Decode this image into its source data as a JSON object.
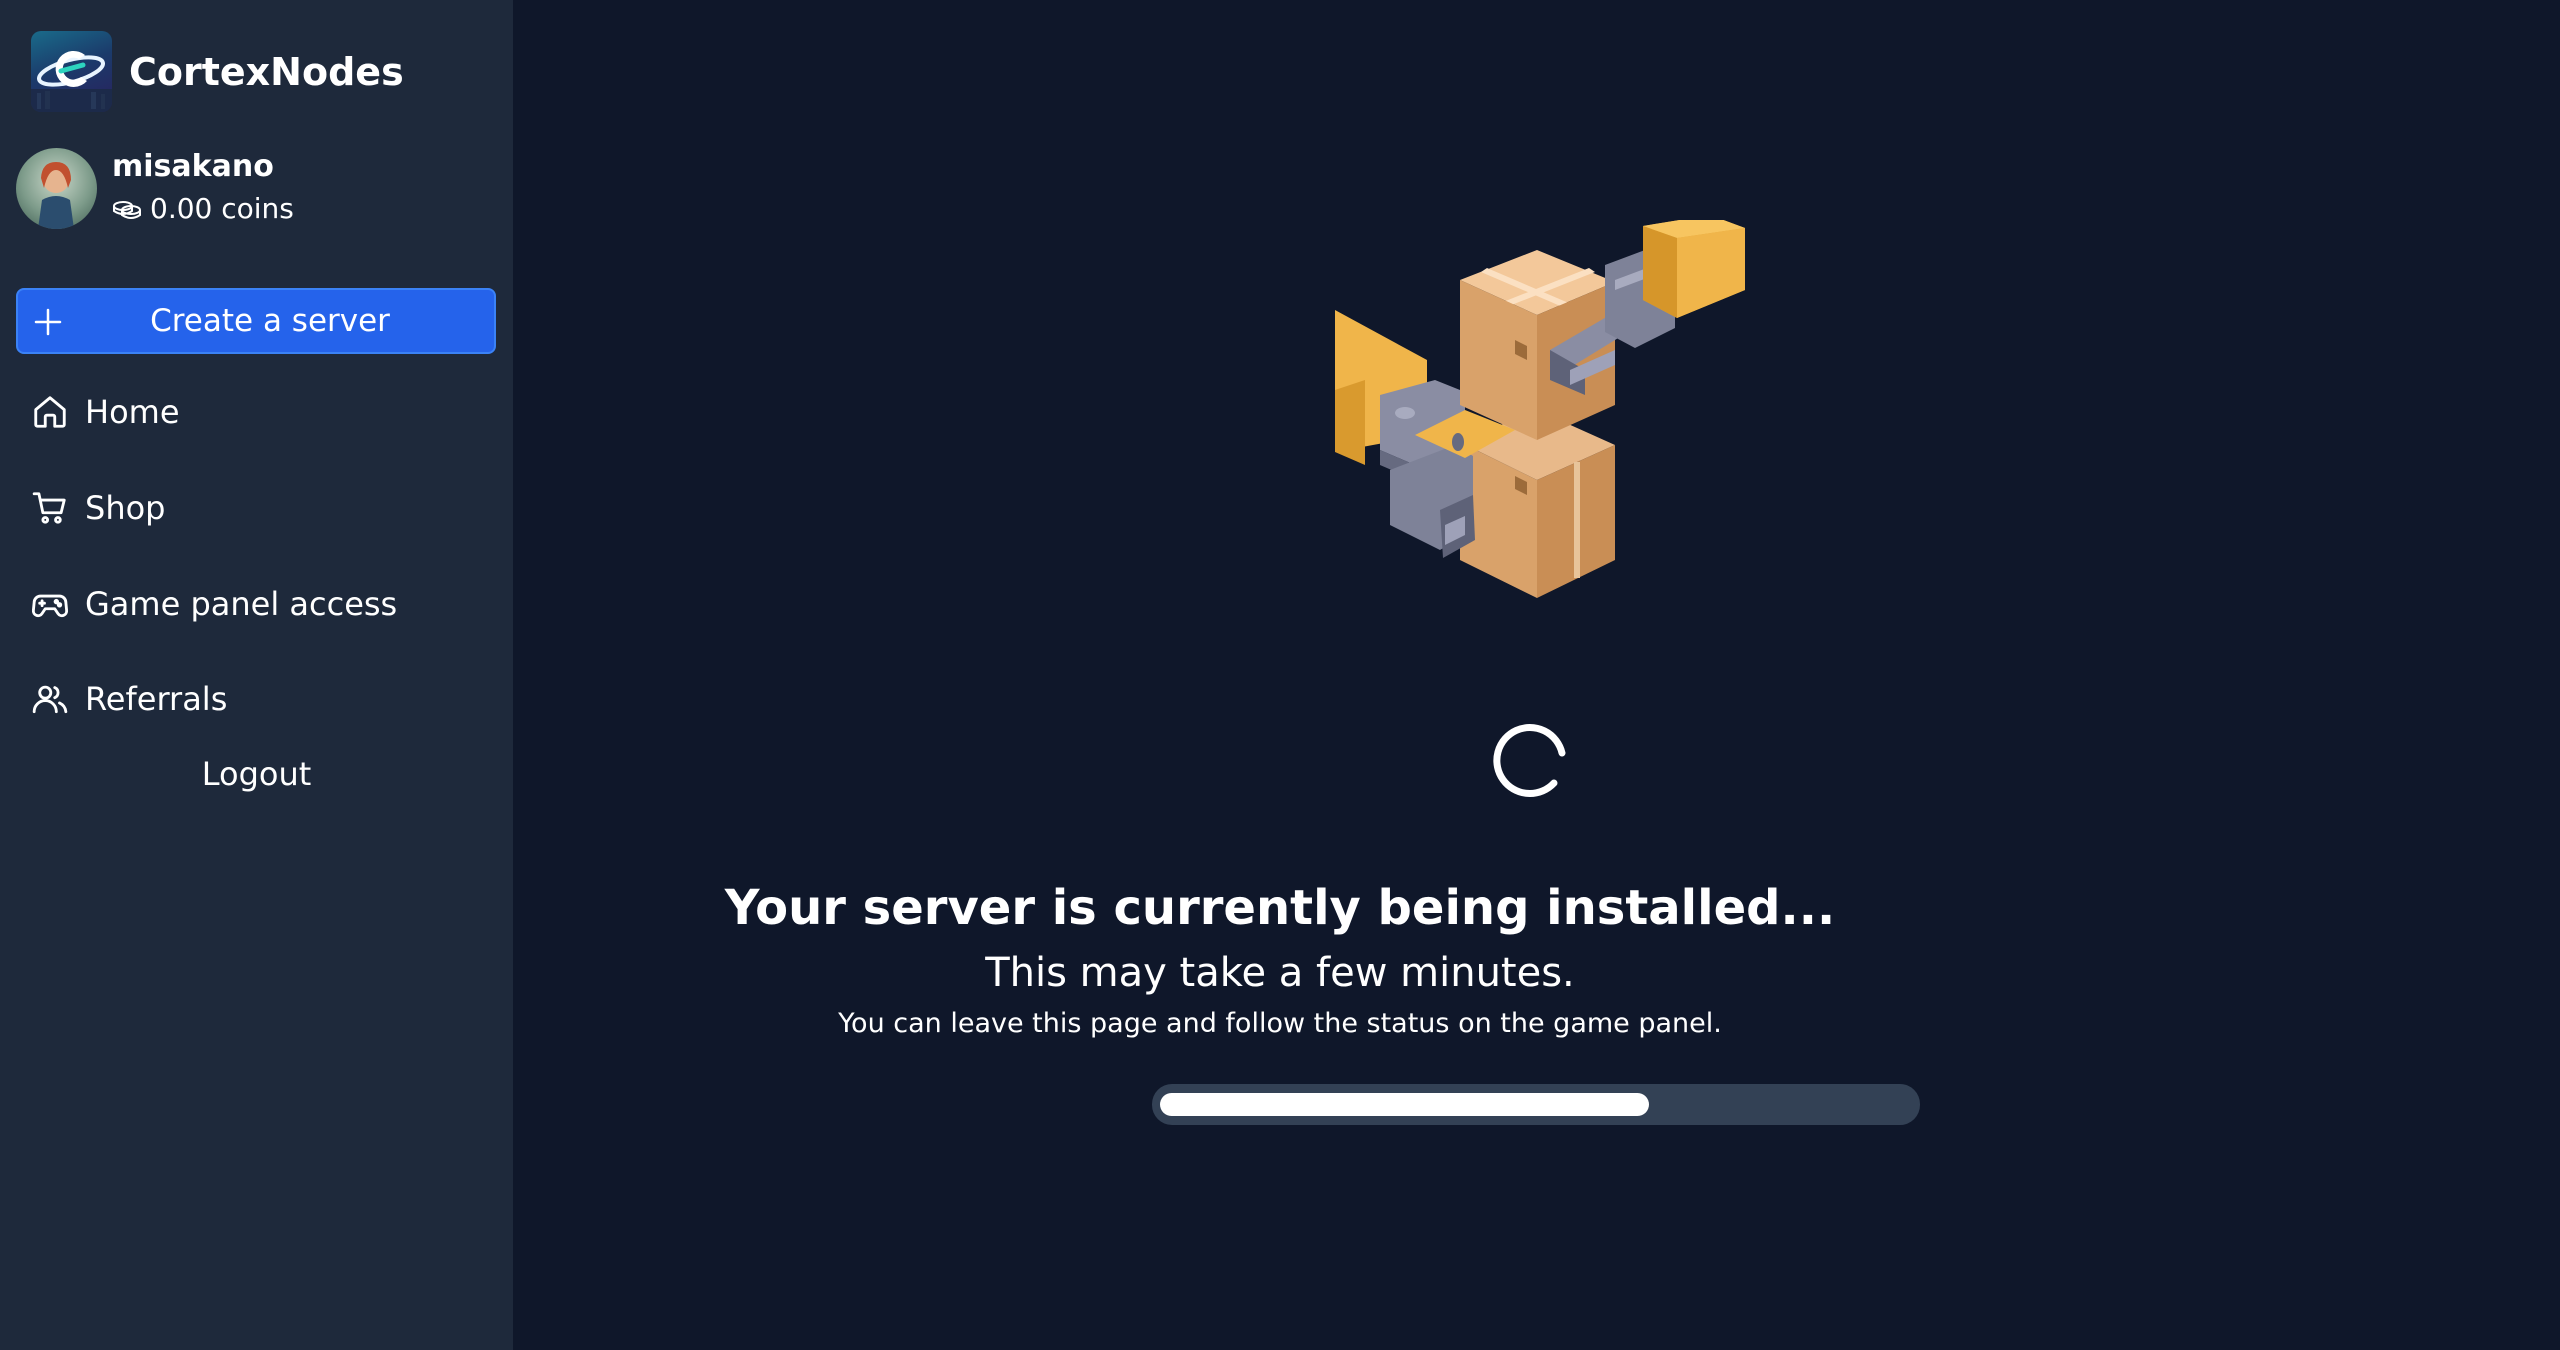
{
  "brand": {
    "name": "CortexNodes",
    "logo_icon": "cortexnodes-logo"
  },
  "user": {
    "username": "misakano",
    "coins": "0.00 coins",
    "coins_icon": "coins-icon"
  },
  "sidebar": {
    "create_button": "Create a server",
    "items": [
      {
        "label": "Home",
        "icon": "home-icon"
      },
      {
        "label": "Shop",
        "icon": "cart-icon"
      },
      {
        "label": "Game panel access",
        "icon": "gamepad-icon"
      },
      {
        "label": "Referrals",
        "icon": "users-icon"
      }
    ],
    "logout": "Logout"
  },
  "main": {
    "title": "Your server is currently being installed...",
    "subtitle": "This may take a few minutes.",
    "note": "You can leave this page and follow the status on the game panel.",
    "progress": 0.65
  },
  "colors": {
    "background": "#0f172a",
    "sidebar": "#1e293b",
    "accent": "#2563eb",
    "progress_track": "#334155",
    "progress_fill": "#ffffff"
  }
}
